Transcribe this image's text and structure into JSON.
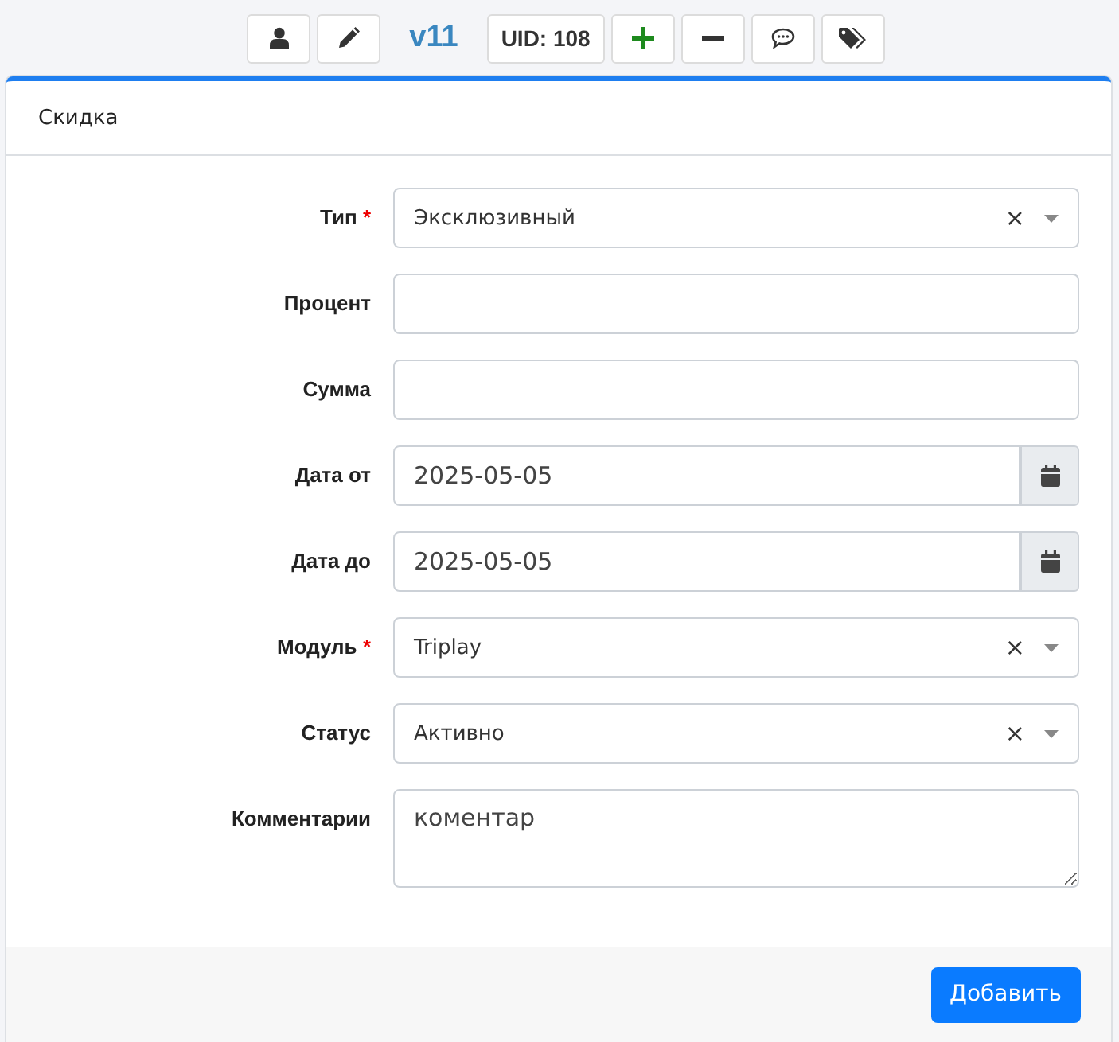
{
  "toolbar": [
    {
      "kind": "user"
    },
    {
      "kind": "edit"
    },
    {
      "kind": "version",
      "text": "v11"
    },
    {
      "kind": "label",
      "text": "UID: 108"
    },
    {
      "kind": "add"
    },
    {
      "kind": "remove"
    },
    {
      "kind": "comment"
    },
    {
      "kind": "tags"
    }
  ],
  "card": {
    "title": "Скидка",
    "fields": [
      {
        "label": "Тип",
        "required_mark": "*",
        "kind": "select",
        "value": "Эксклюзивный",
        "clear": "×"
      },
      {
        "label": "Процент",
        "kind": "text"
      },
      {
        "label": "Сумма",
        "kind": "text"
      },
      {
        "label": "Дата от",
        "kind": "date",
        "value": "2025-05-05"
      },
      {
        "label": "Дата до",
        "kind": "date",
        "value": "2025-05-05"
      },
      {
        "label": "Модуль",
        "required_mark": "*",
        "kind": "select",
        "value": "Triplay",
        "clear": "×"
      },
      {
        "label": "Статус",
        "kind": "select",
        "value": "Активно",
        "clear": "×"
      },
      {
        "label": "Комментарии",
        "kind": "textarea",
        "value": "коментар"
      }
    ],
    "submit": "Добавить"
  }
}
